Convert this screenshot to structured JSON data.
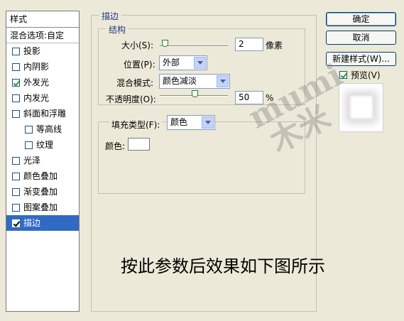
{
  "left_panel": {
    "header": "样式",
    "blend_options": "混合选项:自定",
    "items": [
      {
        "label": "投影",
        "checked": false,
        "sub": false
      },
      {
        "label": "内阴影",
        "checked": false,
        "sub": false
      },
      {
        "label": "外发光",
        "checked": true,
        "sub": false
      },
      {
        "label": "内发光",
        "checked": false,
        "sub": false
      },
      {
        "label": "斜面和浮雕",
        "checked": false,
        "sub": false
      },
      {
        "label": "等高线",
        "checked": false,
        "sub": true
      },
      {
        "label": "纹理",
        "checked": false,
        "sub": true
      },
      {
        "label": "光泽",
        "checked": false,
        "sub": false
      },
      {
        "label": "颜色叠加",
        "checked": false,
        "sub": false
      },
      {
        "label": "渐变叠加",
        "checked": false,
        "sub": false
      },
      {
        "label": "图案叠加",
        "checked": false,
        "sub": false
      },
      {
        "label": "描边",
        "checked": true,
        "sub": false,
        "selected": true
      }
    ]
  },
  "stroke": {
    "title": "描边",
    "structure_title": "结构",
    "size_label": "大小(S):",
    "size_value": "2",
    "size_unit": "像素",
    "position_label": "位置(P):",
    "position_value": "外部",
    "blend_label": "混合模式:",
    "blend_value": "颜色减淡",
    "opacity_label": "不透明度(O):",
    "opacity_value": "50",
    "opacity_unit": "%",
    "fill_type_label": "填充类型(F):",
    "fill_type_value": "颜色",
    "color_label": "颜色:",
    "color_swatch": "#ffffff"
  },
  "buttons": {
    "ok": "确定",
    "cancel": "取消",
    "new_style": "新建样式(W)...",
    "preview": "预览(V)"
  },
  "caption": "按此参数后效果如下图所示",
  "watermark": [
    "mumi",
    "木米"
  ]
}
